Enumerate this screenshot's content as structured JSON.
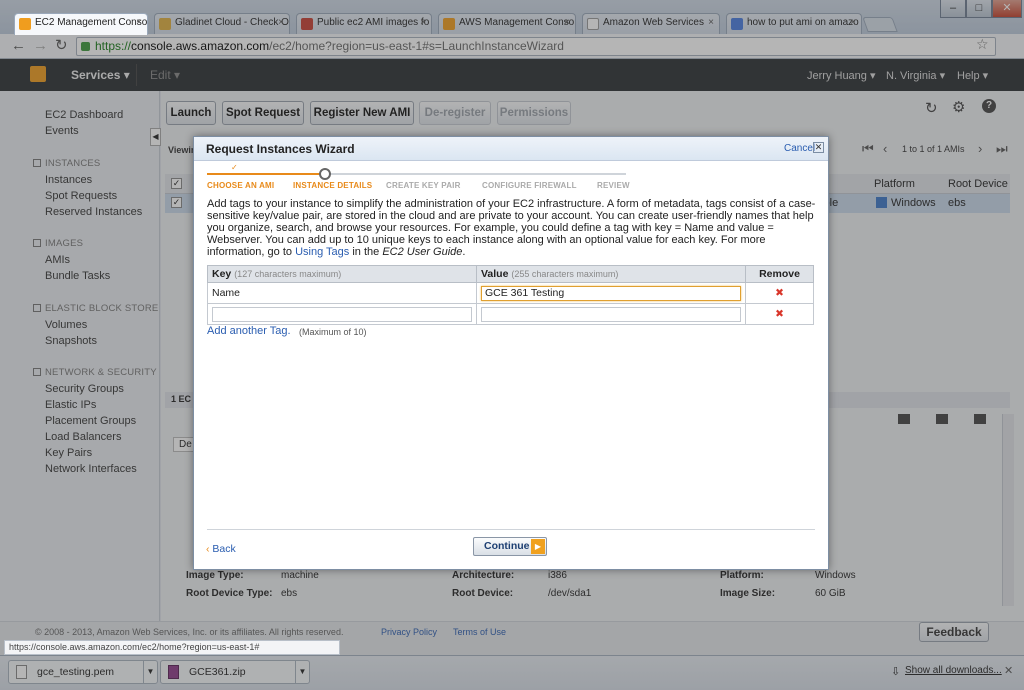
{
  "browser": {
    "tabs": [
      {
        "label": "EC2 Management Console",
        "color": "#f09d1e"
      },
      {
        "label": "Gladinet Cloud - Check O",
        "color": "#e0b040"
      },
      {
        "label": "Public ec2 AMI images fo",
        "color": "#c84032"
      },
      {
        "label": "AWS Management Conso",
        "color": "#f09d1e"
      },
      {
        "label": "Amazon Web Services",
        "color": "#ffffff"
      },
      {
        "label": "how to put ami on amazo",
        "color": "#4a7de0"
      }
    ],
    "close_glyph": "×",
    "url_https": "https://",
    "url_host": "console.aws.amazon.com",
    "url_path": "/ec2/home?region=us-east-1#s=LaunchInstanceWizard",
    "status_url": "https://console.aws.amazon.com/ec2/home?region=us-east-1#"
  },
  "aws_header": {
    "services": "Services",
    "edit": "Edit",
    "user": "Jerry Huang",
    "region": "N. Virginia",
    "help": "Help"
  },
  "sidebar": {
    "top": [
      "EC2 Dashboard",
      "Events"
    ],
    "instances_title": "INSTANCES",
    "instances": [
      "Instances",
      "Spot Requests",
      "Reserved Instances"
    ],
    "images_title": "IMAGES",
    "images": [
      "AMIs",
      "Bundle Tasks"
    ],
    "ebs_title": "ELASTIC BLOCK STORE",
    "ebs": [
      "Volumes",
      "Snapshots"
    ],
    "net_title": "NETWORK & SECURITY",
    "net": [
      "Security Groups",
      "Elastic IPs",
      "Placement Groups",
      "Load Balancers",
      "Key Pairs",
      "Network Interfaces"
    ]
  },
  "toolbar": {
    "launch": "Launch",
    "spot": "Spot Request",
    "register": "Register New AMI",
    "deregister": "De-register",
    "permissions": "Permissions",
    "viewing": "Viewin",
    "pagination": "1 to 1 of 1 AMIs"
  },
  "grid": {
    "col_platform": "Platform",
    "col_root": "Root Device",
    "row_available": "lable",
    "row_platform": "Windows",
    "row_root": "ebs"
  },
  "details": {
    "count": "1 EC",
    "tab": "De",
    "image_type_label": "Image Type:",
    "image_type": "machine",
    "architecture_label": "Architecture:",
    "architecture": "i386",
    "platform_label": "Platform:",
    "platform": "Windows",
    "root_type_label": "Root Device Type:",
    "root_type": "ebs",
    "root_device_label": "Root Device:",
    "root_device": "/dev/sda1",
    "image_size_label": "Image Size:",
    "image_size": "60 GiB"
  },
  "footer": {
    "copyright": "© 2008 - 2013, Amazon Web Services, Inc. or its affiliates. All rights reserved.",
    "privacy": "Privacy Policy",
    "terms": "Terms of Use",
    "feedback": "Feedback"
  },
  "downloads": {
    "items": [
      "gce_testing.pem",
      "GCE361.zip"
    ],
    "show_all": "Show all downloads..."
  },
  "modal": {
    "title": "Request Instances Wizard",
    "cancel": "Cancel",
    "steps": [
      "CHOOSE AN AMI",
      "INSTANCE DETAILS",
      "CREATE KEY PAIR",
      "CONFIGURE FIREWALL",
      "REVIEW"
    ],
    "current_step": 2,
    "description_1": "Add tags to your instance to simplify the administration of your EC2 infrastructure. A form of metadata, tags consist of a case-sensitive key/value pair, are stored in the cloud and are private to your account. You can create user-friendly names that help you organize, search, and browse your resources. For example, you could define a tag with key = Name and value = Webserver. You can add up to 10 unique keys to each instance along with an optional value for each key. For more information, go to ",
    "description_link": "Using Tags",
    "description_2": " in the ",
    "description_guide": "EC2 User Guide",
    "description_3": ".",
    "col_key": "Key",
    "col_key_hint": "(127 characters maximum)",
    "col_value": "Value",
    "col_value_hint": "(255 characters maximum)",
    "col_remove": "Remove",
    "rows": [
      {
        "key": "Name",
        "value": "GCE 361 Testing"
      },
      {
        "key": "",
        "value": ""
      }
    ],
    "remove_glyph": "✖",
    "add_tag": "Add another Tag.",
    "add_tag_max": "(Maximum of 10)",
    "back": "Back",
    "continue": "Continue"
  },
  "colors": {
    "accent_orange": "#e88a1a",
    "link_blue": "#2a5db0",
    "remove_red": "#d9362a",
    "aws_bar": "#2b2f33"
  }
}
